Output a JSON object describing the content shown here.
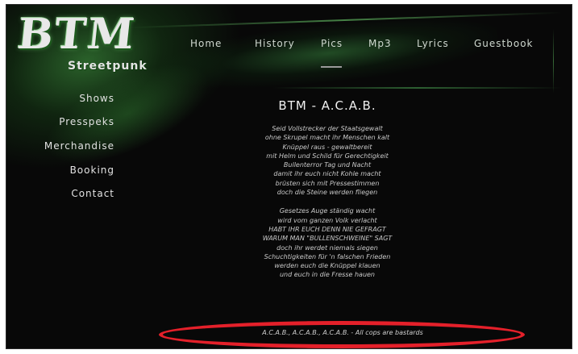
{
  "logo": {
    "main": "BTM",
    "sub": "Streetpunk"
  },
  "nav": {
    "items": [
      "Home",
      "History",
      "Pics",
      "Mp3",
      "Lyrics",
      "Guestbook"
    ]
  },
  "sidebar": {
    "items": [
      "Shows",
      "Presspeks",
      "Merchandise",
      "Booking",
      "Contact"
    ]
  },
  "content": {
    "title": "BTM - A.C.A.B.",
    "stanzas": [
      [
        "Seid Vollstrecker der Staatsgewalt",
        "ohne Skrupel macht ihr Menschen kalt",
        "Knüppel raus - gewaltbereit",
        "mit Helm und Schild für Gerechtigkeit",
        "Bullenterror Tag und Nacht",
        "damit ihr euch nicht Kohle macht",
        "brüsten sich mit Pressestimmen",
        "doch die Steine werden fliegen"
      ],
      [
        "Gesetzes Auge ständig wacht",
        "wird vom ganzen Volk verlacht",
        "HABT IHR EUCH DENN NIE GEFRAGT",
        "WARUM MAN \"BULLENSCHWEINE\" SAGT",
        "doch ihr werdet niemals siegen",
        "Schuchtigkeiten für 'n falschen Frieden",
        "werden euch die Knüppel klauen",
        "und euch in die Fresse hauen"
      ]
    ],
    "footer": "A.C.A.B., A.C.A.B., A.C.A.B. - All cops are bastards"
  },
  "colors": {
    "background": "#080808",
    "accent_green": "#46aa46",
    "highlight_red": "#e4202a"
  }
}
